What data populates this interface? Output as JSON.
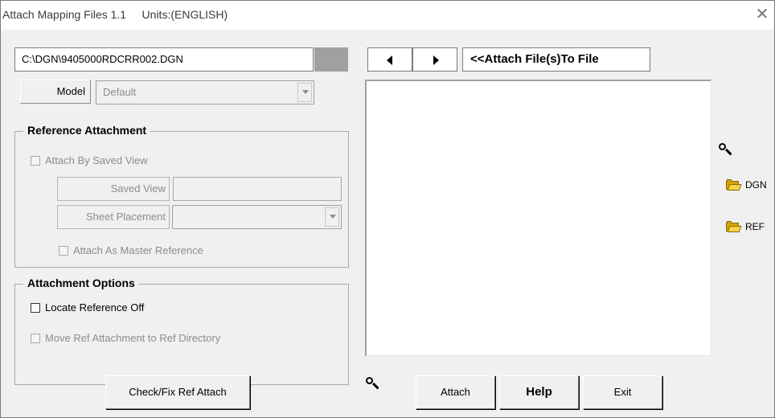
{
  "window": {
    "title": "Attach Mapping Files 1.1",
    "units": "Units:(ENGLISH)",
    "close_glyph": "✕"
  },
  "file": {
    "path": "C:\\DGN\\9405000RDCRR002.DGN"
  },
  "model": {
    "label": "Model",
    "value": "Default"
  },
  "reference_attachment": {
    "title": "Reference Attachment",
    "attach_by_saved_view": "Attach By Saved View",
    "saved_view_label": "Saved View",
    "sheet_placement_label": "Sheet Placement",
    "attach_as_master": "Attach As Master Reference"
  },
  "attachment_options": {
    "title": "Attachment Options",
    "locate_reference_off": "Locate Reference Off",
    "move_ref_attachment": "Move Ref Attachment to Ref Directory"
  },
  "nav": {
    "attach_to_file_label": "<<Attach File(s)To File"
  },
  "side": {
    "dgn_label": "DGN",
    "ref_label": "REF"
  },
  "buttons": {
    "check_fix": "Check/Fix Ref Attach",
    "attach": "Attach",
    "help": "Help",
    "exit": "Exit"
  },
  "icons": {
    "search": "magnifier-icon",
    "folder": "open-folder-icon"
  }
}
